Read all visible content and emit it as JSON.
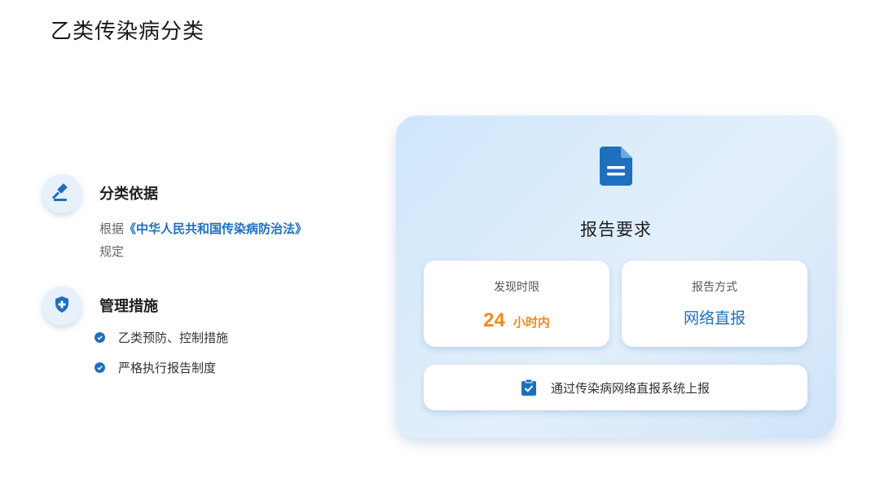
{
  "page": {
    "title": "乙类传染病分类"
  },
  "basis": {
    "heading": "分类依据",
    "prefix": "根据",
    "law": "《中华人民共和国传染病防治法》",
    "suffix": "规定",
    "icon": "gavel-icon"
  },
  "management": {
    "heading": "管理措施",
    "icon": "shield-plus-icon",
    "items": [
      "乙类预防、控制措施",
      "严格执行报告制度"
    ]
  },
  "report": {
    "title": "报告要求",
    "icon": "document-icon",
    "time_limit": {
      "label": "发现时限",
      "number": "24",
      "unit": "小时内"
    },
    "method": {
      "label": "报告方式",
      "value": "网络直报"
    },
    "system": {
      "icon": "clipboard-check-icon",
      "text": "通过传染病网络直报系统上报"
    }
  },
  "colors": {
    "accent_blue": "#1f6fbf",
    "accent_orange": "#f08a17",
    "card_bg": "#d8ebfb"
  }
}
